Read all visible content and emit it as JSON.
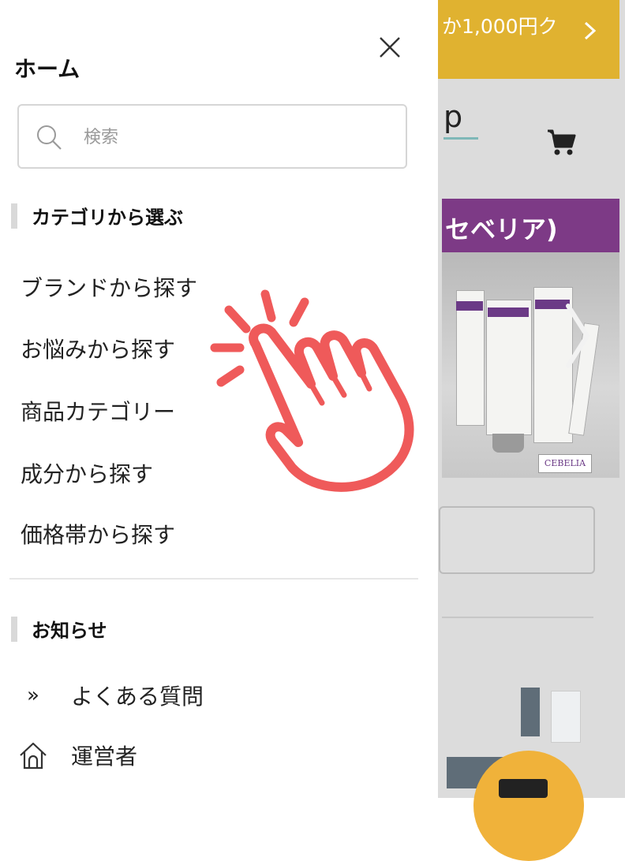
{
  "background_page": {
    "banner_text": "か1,000円ク",
    "header_partial_text": "p",
    "promo_banner_text": "セベリア)",
    "product_brand": "CEBELIA",
    "colors": {
      "banner": "#e0b230",
      "promo": "#7d3a86",
      "fab": "#f0b23a"
    }
  },
  "drawer": {
    "title": "ホーム",
    "search": {
      "placeholder": "検索",
      "icon": "search-icon"
    },
    "category_section": {
      "heading": "カテゴリから選ぶ",
      "items": [
        {
          "label": "ブランドから探す"
        },
        {
          "label": "お悩みから探す"
        },
        {
          "label": "商品カテゴリー"
        },
        {
          "label": "成分から探す"
        },
        {
          "label": "価格帯から探す"
        }
      ]
    },
    "info_section": {
      "heading": "お知らせ",
      "items": [
        {
          "icon": "double-chevron-icon",
          "glyph": "»",
          "label": "よくある質問"
        },
        {
          "icon": "house-icon",
          "label": "運営者"
        }
      ]
    }
  },
  "overlay": {
    "icon": "tap-hand-icon",
    "color": "#ef5a5a"
  }
}
